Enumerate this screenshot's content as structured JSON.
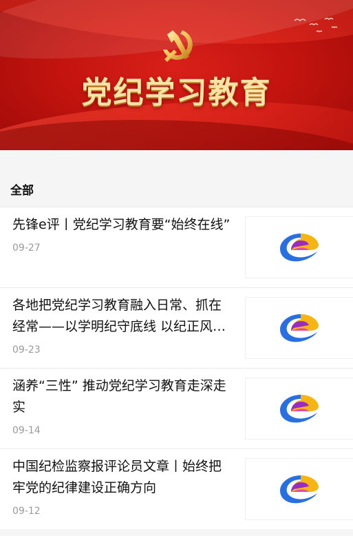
{
  "banner": {
    "title": "党纪学习教育",
    "emblem_icon": "party-emblem-icon",
    "colors": {
      "background": "#c4140f",
      "title": "#f9e3a6"
    }
  },
  "section": {
    "label": "全部"
  },
  "articles": [
    {
      "title": "先锋e评丨党纪学习教育要“始终在线”",
      "date": "09-27",
      "thumb_icon": "e-logo-icon"
    },
    {
      "title": "各地把党纪学习教育融入日常、抓在经常——以学明纪守底线 以纪正风促发展",
      "date": "09-23",
      "thumb_icon": "e-logo-icon"
    },
    {
      "title": "涵养“三性” 推动党纪学习教育走深走实",
      "date": "09-14",
      "thumb_icon": "e-logo-icon"
    },
    {
      "title": "中国纪检监察报评论员文章丨始终把牢党的纪律建设正确方向",
      "date": "09-12",
      "thumb_icon": "e-logo-icon"
    }
  ]
}
